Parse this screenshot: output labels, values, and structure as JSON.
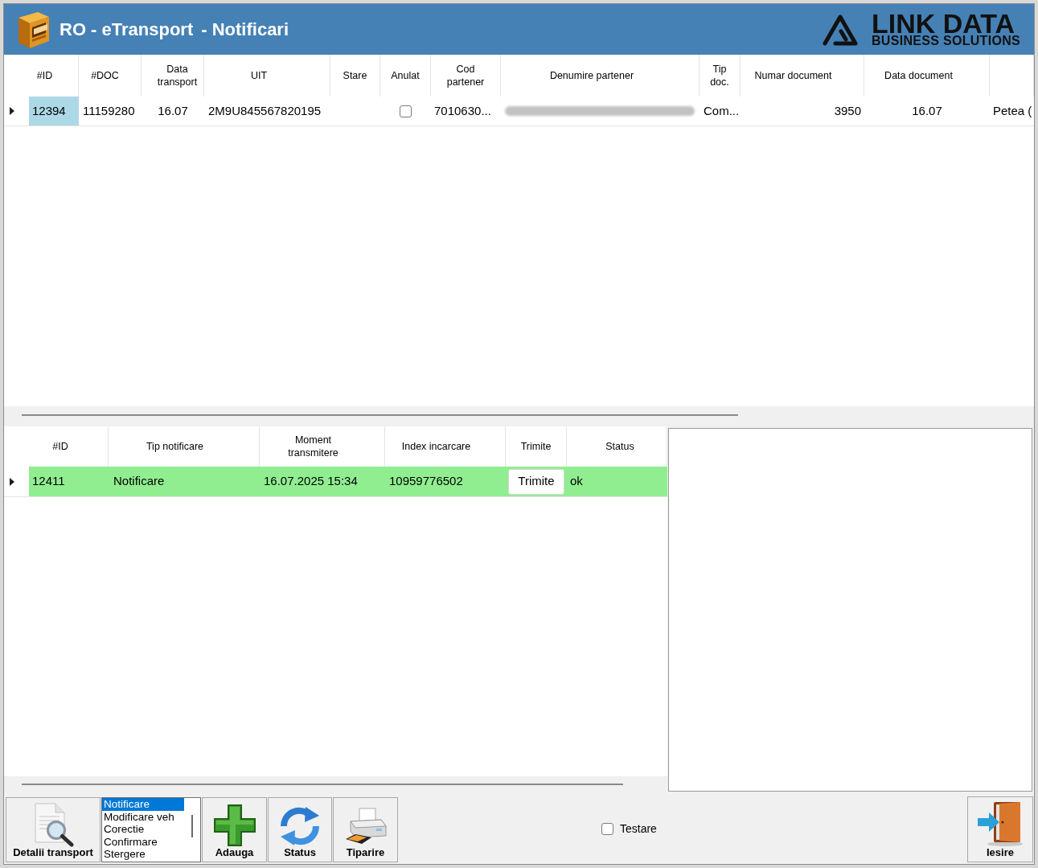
{
  "window": {
    "title": "RO - eTransport",
    "subtitle": "- Notificari"
  },
  "logo": {
    "name": "LINK DATA",
    "tagline": "BUSINESS SOLUTIONS"
  },
  "transports": {
    "columns": [
      "#ID",
      "#DOC",
      "Data transport",
      "UIT",
      "Stare",
      "Anulat",
      "Cod partener",
      "Denumire partener",
      "Tip doc.",
      "Numar document",
      "Data document"
    ],
    "rows": [
      {
        "current": true,
        "cells": [
          {
            "kind": "text",
            "text": "12394",
            "selected": true
          },
          {
            "kind": "text",
            "text": "11159280",
            "selected": false
          },
          {
            "kind": "text",
            "text": "16.07",
            "selected": false
          },
          {
            "kind": "text",
            "text": "2M9U845567820195",
            "selected": false
          },
          {
            "kind": "blank",
            "selected": false
          },
          {
            "kind": "checkbox",
            "checked": false,
            "selected": false
          },
          {
            "kind": "text",
            "text": "7010630...",
            "selected": false
          },
          {
            "kind": "blurred",
            "selected": false
          },
          {
            "kind": "text",
            "text": "Com...",
            "selected": false
          },
          {
            "kind": "text",
            "text": "3950",
            "selected": false
          },
          {
            "kind": "text",
            "text": "16.07",
            "selected": false
          },
          {
            "kind": "text",
            "text": "Petea (",
            "selected": false
          }
        ]
      }
    ]
  },
  "notifications": {
    "columns": [
      "#ID",
      "Tip notificare",
      "Moment transmitere",
      "Index incarcare",
      "Trimite",
      "Status"
    ],
    "rows": [
      {
        "current": true,
        "color": "#90ee90",
        "cells": [
          {
            "kind": "text",
            "text": "12411"
          },
          {
            "kind": "text",
            "text": "Notificare"
          },
          {
            "kind": "text",
            "text": "16.07.2025 15:34"
          },
          {
            "kind": "text",
            "text": "10959776502"
          },
          {
            "kind": "button",
            "text": "Trimite"
          },
          {
            "kind": "text",
            "text": "ok"
          }
        ]
      }
    ]
  },
  "toolbar": {
    "items": [
      {
        "kind": "button",
        "label": "Detalii transport"
      },
      {
        "kind": "listbox",
        "items": [
          {
            "label": "Notificare",
            "selected": true
          },
          {
            "label": "Modificare veh",
            "selected": false
          },
          {
            "label": "Corectie",
            "selected": false
          },
          {
            "label": "Confirmare",
            "selected": false
          },
          {
            "label": "Stergere",
            "selected": false
          }
        ]
      },
      {
        "kind": "button",
        "label": "Adauga"
      },
      {
        "kind": "button",
        "label": "Status"
      },
      {
        "kind": "button",
        "label": "Tiparire"
      }
    ]
  },
  "testare": {
    "label": "Testare",
    "checked": false
  },
  "exit": {
    "label": "Iesire"
  }
}
